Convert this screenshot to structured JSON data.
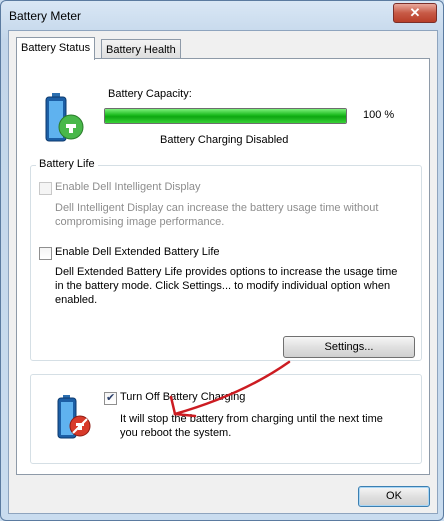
{
  "window": {
    "title": "Battery Meter",
    "close_glyph": "✕"
  },
  "tabs": [
    {
      "label": "Battery Status"
    },
    {
      "label": "Battery Health"
    }
  ],
  "battery": {
    "capacity_label": "Battery Capacity:",
    "capacity_percent": 100,
    "capacity_text": "100 %",
    "charging_status": "Battery Charging Disabled",
    "icon": "battery-plug-icon"
  },
  "battery_life": {
    "group_title": "Battery Life",
    "intelligent_display": {
      "label": "Enable Dell Intelligent Display",
      "checked": false,
      "enabled": false,
      "description_line1": "Dell Intelligent Display can increase the battery usage time without",
      "description_line2": "compromising image performance."
    },
    "extended_life": {
      "label": "Enable Dell Extended Battery Life",
      "checked": false,
      "enabled": true,
      "description_line1": "Dell Extended Battery Life provides options to increase the usage time",
      "description_line2": "in the battery mode. Click Settings... to modify individual option when",
      "description_line3": "enabled."
    },
    "settings_button": "Settings..."
  },
  "charging": {
    "label": "Turn Off Battery Charging",
    "checked": true,
    "description_line1": "It will stop the battery from charging until the next time",
    "description_line2": "you reboot the system.",
    "icon": "battery-no-charge-icon"
  },
  "footer": {
    "ok_label": "OK"
  },
  "colors": {
    "progress_green": "#18b91b",
    "annotation_red": "#cc1c22"
  }
}
